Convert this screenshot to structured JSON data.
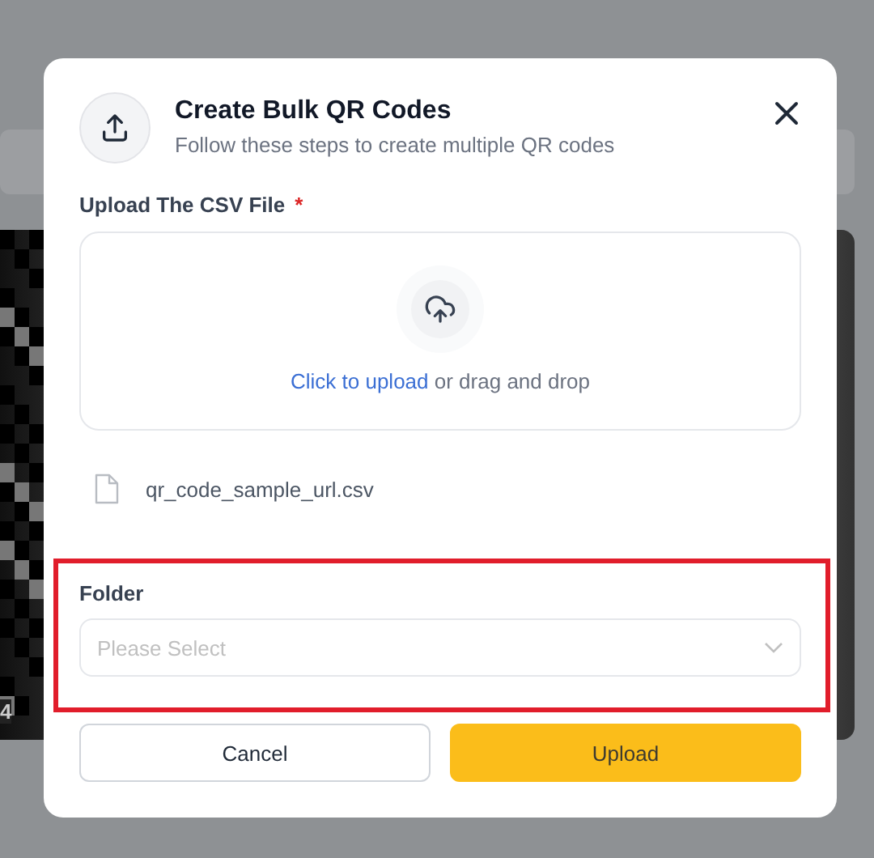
{
  "background": {
    "card_label": "4"
  },
  "dialog": {
    "title": "Create Bulk QR Codes",
    "subtitle": "Follow these steps to create multiple QR codes",
    "upload_label": "Upload The CSV File",
    "required_mark": "*",
    "dropzone": {
      "link": "Click to upload",
      "text": "or drag and drop"
    },
    "file": {
      "name": "qr_code_sample_url.csv"
    },
    "folder": {
      "label": "Folder",
      "placeholder": "Please Select"
    },
    "buttons": [
      {
        "kind": "secondary",
        "label": "Cancel"
      },
      {
        "kind": "primary",
        "label": "Upload"
      }
    ]
  }
}
